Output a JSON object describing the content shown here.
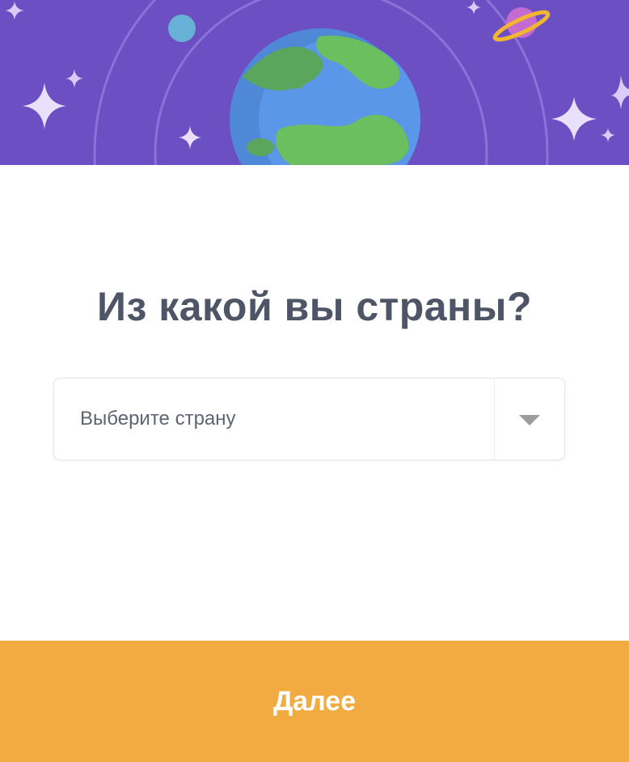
{
  "question": {
    "title": "Из какой вы страны?"
  },
  "country_select": {
    "placeholder": "Выберите страну"
  },
  "actions": {
    "next_label": "Далее"
  },
  "colors": {
    "banner_bg": "#6a4fc3",
    "accent": "#f2ab41",
    "title_text": "#4d5566"
  },
  "icons": {
    "banner": "earth-space-illustration",
    "dropdown": "caret-down-icon"
  }
}
